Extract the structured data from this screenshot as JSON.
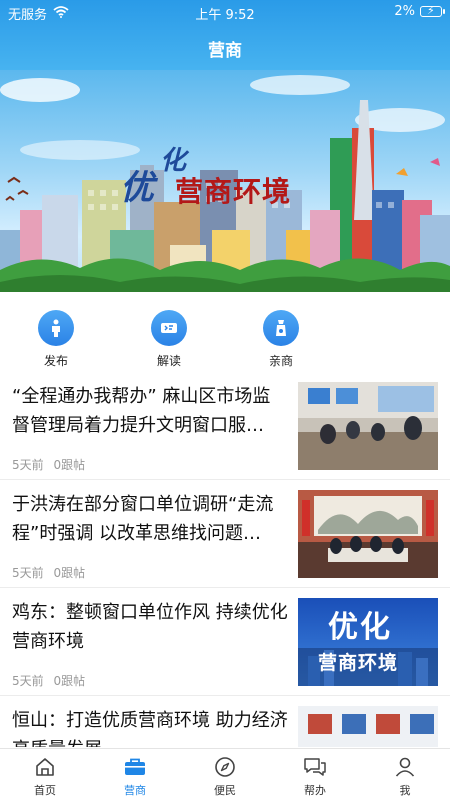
{
  "status_bar": {
    "carrier": "无服务",
    "time": "上午 9:52",
    "battery": "2%"
  },
  "header": {
    "title": "营商"
  },
  "banner": {
    "title_you": "优",
    "title_hua": "化",
    "title_main": "营商环境"
  },
  "quick_actions": [
    {
      "label": "发布",
      "icon": "publish-icon"
    },
    {
      "label": "解读",
      "icon": "interpret-icon"
    },
    {
      "label": "亲商",
      "icon": "pro-business-icon"
    }
  ],
  "news": [
    {
      "title": "“全程通办我帮办” 麻山区市场监督管理局着力提升文明窗口服…",
      "time": "5天前",
      "replies": "0跟帖"
    },
    {
      "title": "于洪涛在部分窗口单位调研“走流程”时强调 以改革思维找问题…",
      "time": "5天前",
      "replies": "0跟帖"
    },
    {
      "title": "鸡东：整顿窗口单位作风 持续优化营商环境",
      "time": "5天前",
      "replies": "0跟帖",
      "thumb_text_1": "优化",
      "thumb_text_2": "营商环境"
    },
    {
      "title": "恒山：打造优质营商环境 助力经济高质量发展",
      "time": "",
      "replies": ""
    }
  ],
  "tabs": [
    {
      "label": "首页",
      "icon": "home-icon",
      "active": false
    },
    {
      "label": "营商",
      "icon": "briefcase-icon",
      "active": true
    },
    {
      "label": "便民",
      "icon": "compass-icon",
      "active": false
    },
    {
      "label": "帮办",
      "icon": "chat-icon",
      "active": false
    },
    {
      "label": "我",
      "icon": "user-icon",
      "active": false
    }
  ],
  "colors": {
    "accent": "#1f86e6",
    "header": "#2a9be8",
    "banner_red": "#b31818"
  }
}
